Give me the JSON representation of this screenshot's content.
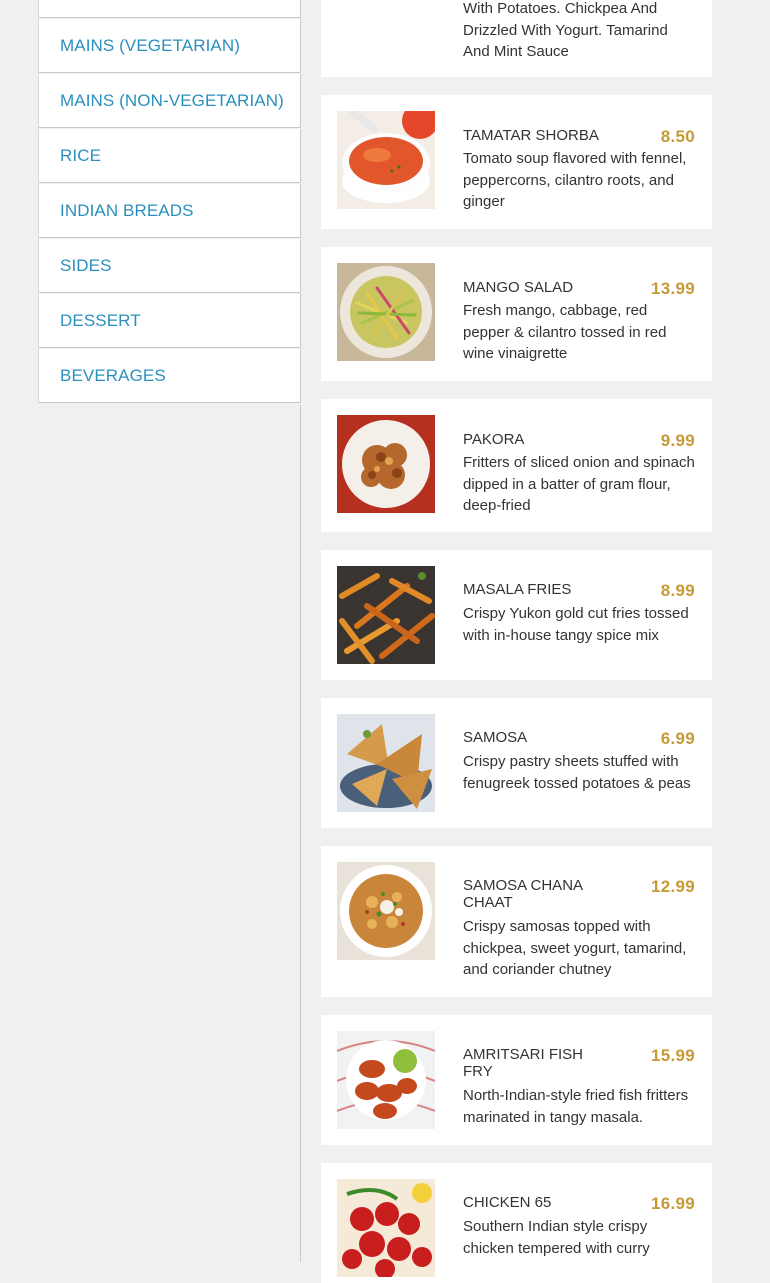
{
  "categories": {
    "items": [
      "",
      "MAINS (VEGETARIAN)",
      "MAINS (NON-VEGETARIAN)",
      "RICE",
      "INDIAN BREADS",
      "SIDES",
      "DESSERT",
      "BEVERAGES"
    ]
  },
  "menu": {
    "items": [
      {
        "name": "",
        "price": "",
        "description": "With Potatoes. Chickpea And Drizzled With Yogurt. Tamarind And Mint Sauce",
        "image": "none"
      },
      {
        "name": "TAMATAR SHORBA",
        "price": "8.50",
        "description": "Tomato soup flavored with fennel, peppercorns, cilantro roots, and ginger",
        "image": "tomato-soup-photo"
      },
      {
        "name": "MANGO SALAD",
        "price": "13.99",
        "description": "Fresh mango, cabbage, red pepper & cilantro tossed in red wine vinaigrette",
        "image": "mango-salad-photo"
      },
      {
        "name": "PAKORA",
        "price": "9.99",
        "description": "Fritters of sliced onion and spinach dipped in a batter of gram flour, deep-fried",
        "image": "pakora-photo"
      },
      {
        "name": "MASALA FRIES",
        "price": "8.99",
        "description": "Crispy Yukon gold cut fries tossed with in-house tangy spice mix",
        "image": "masala-fries-photo"
      },
      {
        "name": "SAMOSA",
        "price": "6.99",
        "description": "Crispy pastry sheets stuffed with fenugreek tossed potatoes & peas",
        "image": "samosa-photo"
      },
      {
        "name": "SAMOSA CHANA CHAAT",
        "price": "12.99",
        "description": "Crispy samosas topped with chickpea, sweet yogurt, tamarind, and coriander chutney",
        "image": "samosa-chaat-photo"
      },
      {
        "name": "AMRITSARI FISH FRY",
        "price": "15.99",
        "description": "North-Indian-style fried fish fritters marinated in tangy masala.",
        "image": "fish-fry-photo"
      },
      {
        "name": "CHICKEN 65",
        "price": "16.99",
        "description": "Southern Indian style crispy chicken tempered with curry",
        "image": "chicken-65-photo"
      }
    ]
  },
  "colors": {
    "category_text": "#2a8fbd",
    "price": "#c69a35",
    "background": "#f0f0f0",
    "card": "#ffffff"
  }
}
